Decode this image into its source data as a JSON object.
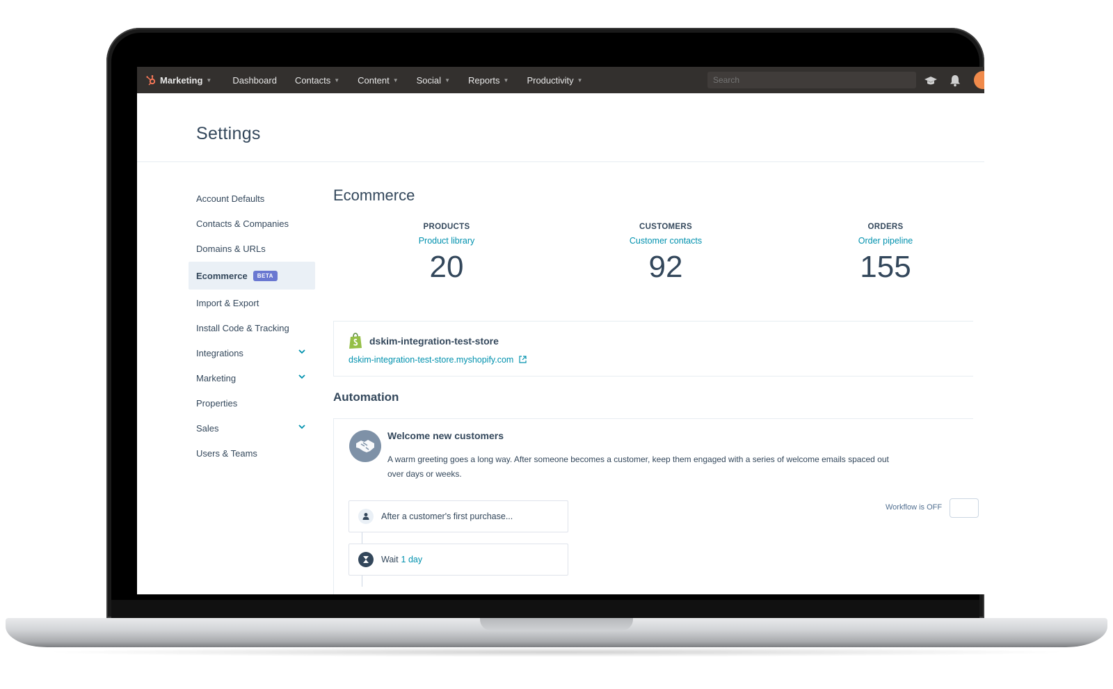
{
  "nav": {
    "brand": "Marketing",
    "items": [
      {
        "label": "Dashboard",
        "caret": false
      },
      {
        "label": "Contacts",
        "caret": true
      },
      {
        "label": "Content",
        "caret": true
      },
      {
        "label": "Social",
        "caret": true
      },
      {
        "label": "Reports",
        "caret": true
      },
      {
        "label": "Productivity",
        "caret": true
      }
    ],
    "search_placeholder": "Search",
    "icons": [
      "academy-icon",
      "bell-icon",
      "avatar"
    ],
    "bar_color": "#33302e"
  },
  "page": {
    "title": "Settings"
  },
  "sidebar": {
    "items": [
      {
        "label": "Account Defaults"
      },
      {
        "label": "Contacts & Companies"
      },
      {
        "label": "Domains & URLs"
      },
      {
        "label": "Ecommerce",
        "active": true,
        "badge": "BETA"
      },
      {
        "label": "Import & Export"
      },
      {
        "label": "Install Code & Tracking"
      },
      {
        "label": "Integrations",
        "expandable": true
      },
      {
        "label": "Marketing",
        "expandable": true
      },
      {
        "label": "Properties"
      },
      {
        "label": "Sales",
        "expandable": true
      },
      {
        "label": "Users & Teams"
      }
    ]
  },
  "main": {
    "title": "Ecommerce",
    "stats": [
      {
        "label": "PRODUCTS",
        "link": "Product library",
        "value": "20"
      },
      {
        "label": "CUSTOMERS",
        "link": "Customer contacts",
        "value": "92"
      },
      {
        "label": "ORDERS",
        "link": "Order pipeline",
        "value": "155"
      }
    ],
    "store": {
      "name": "dskim-integration-test-store",
      "url": "dskim-integration-test-store.myshopify.com"
    },
    "automation": {
      "title": "Automation",
      "workflow": {
        "title": "Welcome new customers",
        "description": "A warm greeting goes a long way. After someone becomes a customer, keep them engaged with a series of welcome emails spaced out over days or weeks.",
        "status": "Workflow is OFF",
        "steps": [
          {
            "text": "After a customer's first purchase..."
          },
          {
            "text": "Wait",
            "link": "1 day"
          }
        ]
      }
    }
  },
  "colors": {
    "accent_link": "#0091ae",
    "text": "#33475b",
    "badge": "#6a78d1",
    "brand_orange": "#ff7a59"
  }
}
